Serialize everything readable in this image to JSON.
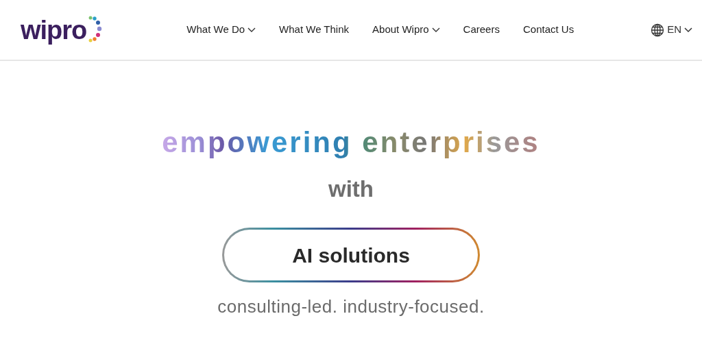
{
  "logo": {
    "text": "wipro"
  },
  "nav": [
    {
      "label": "What We Do",
      "has_menu": true
    },
    {
      "label": "What We Think",
      "has_menu": false
    },
    {
      "label": "About Wipro",
      "has_menu": true
    },
    {
      "label": "Careers",
      "has_menu": false
    },
    {
      "label": "Contact Us",
      "has_menu": false
    }
  ],
  "language": {
    "label": "EN"
  },
  "hero": {
    "headline": "empowering enterprises",
    "connector": "with",
    "pill": "AI solutions",
    "tagline": "consulting-led. industry-focused."
  }
}
